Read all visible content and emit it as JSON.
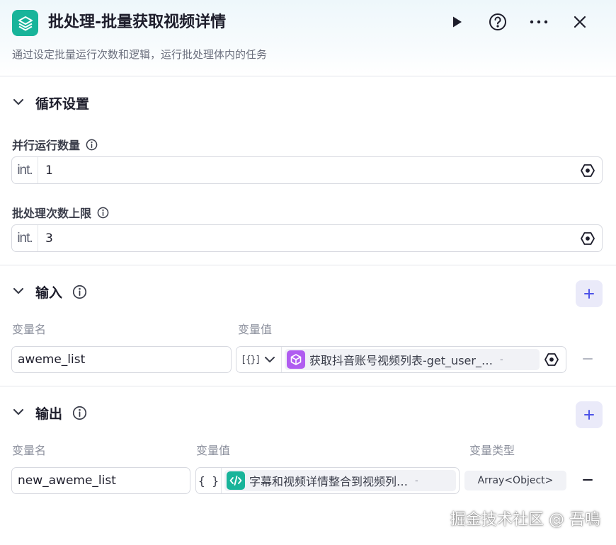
{
  "header": {
    "title": "批处理-批量获取视频详情",
    "subtitle": "通过设定批量运行次数和逻辑，运行批处理体内的任务",
    "logo_icon": "layers-icon",
    "actions": [
      "play-icon",
      "help-icon",
      "more-icon",
      "close-icon"
    ]
  },
  "loop": {
    "title": "循环设置",
    "parallel": {
      "label": "并行运行数量",
      "type": "int.",
      "value": "1"
    },
    "limit": {
      "label": "批处理次数上限",
      "type": "int.",
      "value": "3"
    }
  },
  "input": {
    "title": "输入",
    "col_name": "变量名",
    "col_value": "变量值",
    "row": {
      "name": "aweme_list",
      "ref_type_icon": "array-object-icon",
      "ref_text": "获取抖音账号视频列表-get_user_…",
      "ref_dash": "-"
    }
  },
  "output": {
    "title": "输出",
    "col_name": "变量名",
    "col_value": "变量值",
    "col_type": "变量类型",
    "row": {
      "name": "new_aweme_list",
      "ref_text": "字幕和视频详情整合到视频列…",
      "ref_dash": "-",
      "type": "Array<Object>"
    }
  },
  "watermark": "掘金技术社区 @ 吾鳴",
  "colors": {
    "accent": "#18b49a",
    "add_btn": "#eaeaf9",
    "plugin": "#b05cf0",
    "code": "#18b49a"
  }
}
